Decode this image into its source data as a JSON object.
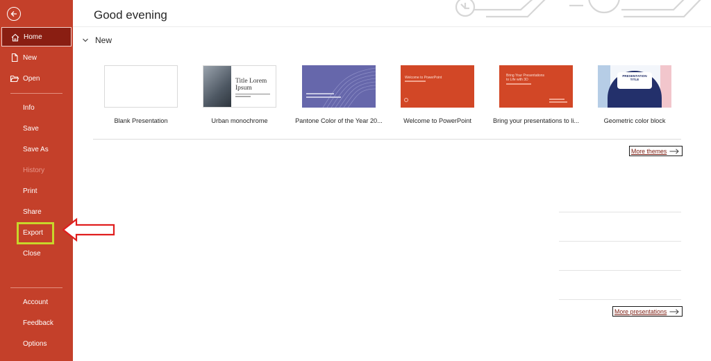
{
  "sidebar": {
    "items": [
      {
        "label": "Home",
        "icon": "home-icon",
        "selected": true
      },
      {
        "label": "New",
        "icon": "new-file-icon"
      },
      {
        "label": "Open",
        "icon": "folder-open-icon"
      },
      {
        "label": "Info"
      },
      {
        "label": "Save"
      },
      {
        "label": "Save As"
      },
      {
        "label": "History",
        "disabled": true
      },
      {
        "label": "Print"
      },
      {
        "label": "Share"
      },
      {
        "label": "Export",
        "highlighted": true
      },
      {
        "label": "Close"
      },
      {
        "label": "Account"
      },
      {
        "label": "Feedback"
      },
      {
        "label": "Options"
      }
    ],
    "back_icon": "back-arrow-icon",
    "color": "#c4402a",
    "selected_color": "#8a1e12"
  },
  "main": {
    "greeting": "Good evening",
    "new_section": {
      "label": "New",
      "templates": [
        {
          "name": "Blank Presentation"
        },
        {
          "name": "Urban monochrome",
          "thumb_title": "Title Lorem Ipsum"
        },
        {
          "name": "Pantone Color of the Year 20..."
        },
        {
          "name": "Welcome to PowerPoint",
          "thumb_title": "Welcome to PowerPoint"
        },
        {
          "name": "Bring your presentations to li...",
          "thumb_title": "Bring Your Presentations to Life with 3D"
        },
        {
          "name": "Geometric color block",
          "thumb_title": "PRESENTATION TITLE"
        }
      ]
    },
    "more_themes": "More themes",
    "more_presentations": "More presentations"
  },
  "annotation": {
    "highlight_color": "#c8d62b",
    "arrow_color": "#e01e1e"
  }
}
